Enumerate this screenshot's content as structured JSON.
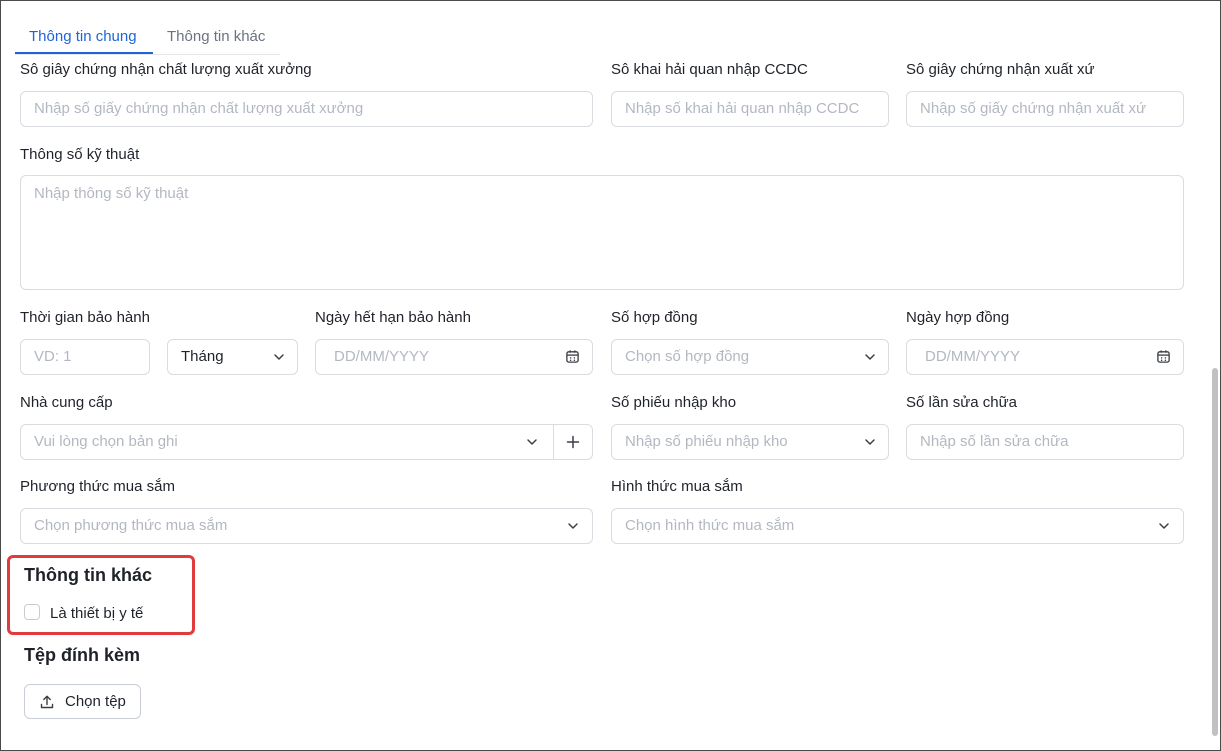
{
  "tabs": {
    "general": "Thông tin chung",
    "other": "Thông tin khác"
  },
  "fields": {
    "quality_cert": {
      "label": "Sô giây chứng nhận chất lượng xuất xưởng",
      "placeholder": "Nhập số giấy chứng nhận chất lượng xuất xưởng"
    },
    "customs_decl": {
      "label": "Sô khai hải quan nhập CCDC",
      "placeholder": "Nhập số khai hải quan nhập CCDC"
    },
    "origin_cert": {
      "label": "Sô giây chứng nhận xuất xứ",
      "placeholder": "Nhập số giấy chứng nhận xuất xứ"
    },
    "specs": {
      "label": "Thông số kỹ thuật",
      "placeholder": "Nhập thông số kỹ thuật"
    },
    "warranty_time": {
      "label": "Thời gian bảo hành",
      "placeholder": "VD: 1",
      "unit_value": "Tháng"
    },
    "warranty_expiry": {
      "label": "Ngày hết hạn bảo hành",
      "placeholder": "DD/MM/YYYY"
    },
    "contract_no": {
      "label": "Số hợp đồng",
      "placeholder": "Chọn số hợp đồng"
    },
    "contract_date": {
      "label": "Ngày hợp đồng",
      "placeholder": "DD/MM/YYYY"
    },
    "supplier": {
      "label": "Nhà cung cấp",
      "placeholder": "Vui lòng chọn bản ghi"
    },
    "receipt_no": {
      "label": "Số phiếu nhập kho",
      "placeholder": "Nhập số phiếu nhập kho"
    },
    "repair_count": {
      "label": "Số lần sửa chữa",
      "placeholder": "Nhập số lần sửa chữa"
    },
    "purchase_method": {
      "label": "Phương thức mua sắm",
      "placeholder": "Chọn phương thức mua sắm"
    },
    "purchase_form": {
      "label": "Hình thức mua sắm",
      "placeholder": "Chọn hình thức mua sắm"
    }
  },
  "other_info": {
    "title": "Thông tin khác",
    "medical_device_label": "Là thiết bị y tế",
    "medical_device_checked": false
  },
  "attachments": {
    "title": "Tệp đính kèm",
    "choose_file_label": "Chọn tệp"
  },
  "colors": {
    "accent": "#1f64d6",
    "highlight": "#e23b3b",
    "border": "#d9dce1",
    "placeholder": "#b3b8c0"
  }
}
